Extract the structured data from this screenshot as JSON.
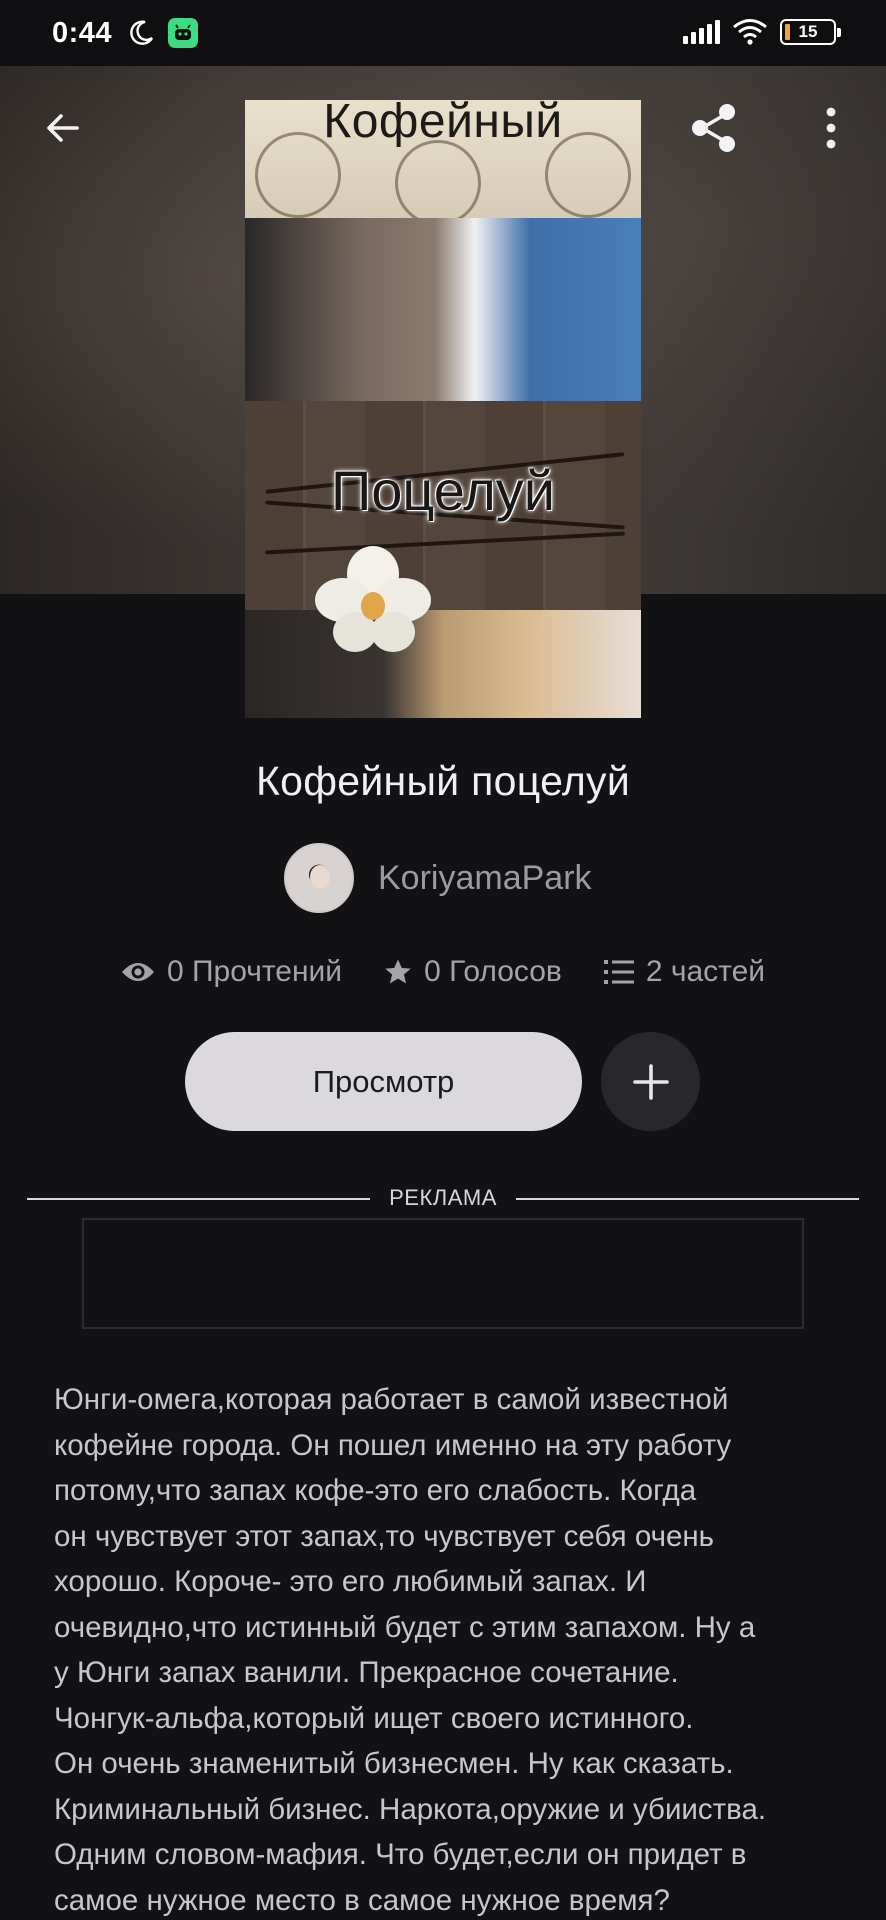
{
  "status_bar": {
    "time": "0:44",
    "battery": "15",
    "colors": {
      "battery_low": "#f2a33a",
      "app_icon": "#3ddc84"
    }
  },
  "topbar": {
    "back_icon": "arrow-left-icon",
    "share_icon": "share-icon",
    "more_icon": "more-vertical-icon"
  },
  "cover": {
    "title_line_1": "Кофейный",
    "title_line_2": "Поцелуй"
  },
  "story": {
    "title": "Кофейный поцелуй",
    "author": "KoriyamaPark"
  },
  "stats": [
    {
      "icon": "eye-icon",
      "label": "0 Прочтений"
    },
    {
      "icon": "star-icon",
      "label": "0 Голосов"
    },
    {
      "icon": "list-icon",
      "label": "2 частей"
    }
  ],
  "actions": {
    "read_label": "Просмотр",
    "add_icon": "plus-icon"
  },
  "ad": {
    "label": "РЕКЛАМА"
  },
  "description": "Юнги-омега,которая работает в самой известной\nкофейне города. Он пошел именно на эту работу\nпотому,что запах кофе-это его слабость. Когда\nон чувствует этот запах,то чувствует себя очень\nхорошо. Короче- это его любимый запах. И\nочевидно,что истинный будет с этим запахом. Ну а\nу Юнги запах ванили. Прекрасное сочетание.\nЧонгук-альфа,который ищет своего истинного.\nОн очень знаменитый бизнесмен. Ну как сказать.\nКриминальный бизнес. Наркота,оружие и убииства.\nОдним словом-мафия. Что будет,если он придет в\nсамое нужное место в самое нужное время?"
}
